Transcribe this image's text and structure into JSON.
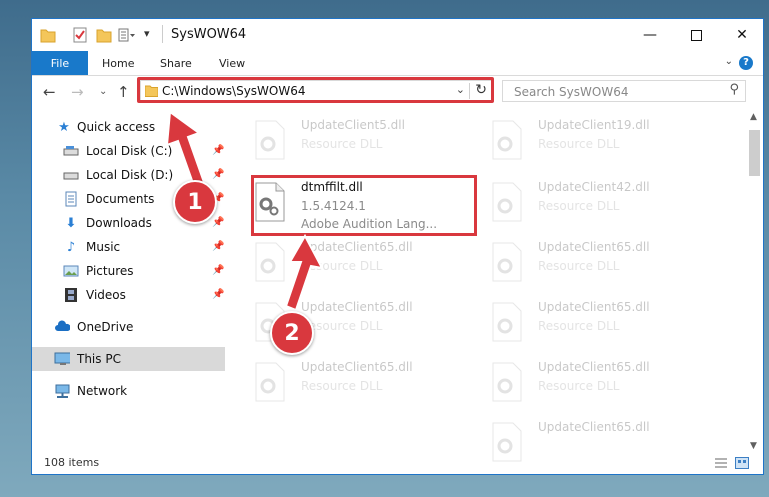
{
  "window": {
    "title": "SysWOW64"
  },
  "ribbon": {
    "file": "File",
    "tabs": [
      "Home",
      "Share",
      "View"
    ],
    "help": "?"
  },
  "address": {
    "path": "C:\\Windows\\SysWOW64"
  },
  "search": {
    "placeholder": "Search SysWOW64"
  },
  "sidebar": {
    "items": [
      {
        "label": "Quick access",
        "icon": "star-icon"
      },
      {
        "label": "Local Disk (C:)",
        "icon": "drive-icon"
      },
      {
        "label": "Local Disk (D:)",
        "icon": "drive-icon"
      },
      {
        "label": "Documents",
        "icon": "documents-icon"
      },
      {
        "label": "Downloads",
        "icon": "download-arrow-icon"
      },
      {
        "label": "Music",
        "icon": "music-note-icon"
      },
      {
        "label": "Pictures",
        "icon": "pictures-icon"
      },
      {
        "label": "Videos",
        "icon": "film-icon"
      },
      {
        "label": "OneDrive",
        "icon": "cloud-icon"
      },
      {
        "label": "This PC",
        "icon": "computer-icon"
      },
      {
        "label": "Network",
        "icon": "network-icon"
      }
    ]
  },
  "files": [
    {
      "name": "UpdateClient5.dll",
      "type": "Resource DLL"
    },
    {
      "name": "UpdateClient19.dll",
      "type": "Resource DLL"
    },
    {
      "name": "dtmffilt.dll",
      "version": "1.5.4124.1",
      "description": "Adobe Audition Lang..."
    },
    {
      "name": "UpdateClient42.dll",
      "type": "Resource DLL"
    },
    {
      "name": "UpdateClient65.dll",
      "type": "Resource DLL"
    },
    {
      "name": "UpdateClient65.dll",
      "type": "Resource DLL"
    },
    {
      "name": "UpdateClient65.dll",
      "type": "Resource DLL"
    },
    {
      "name": "UpdateClient65.dll",
      "type": "Resource DLL"
    },
    {
      "name": "UpdateClient65.dll",
      "type": "Resource DLL"
    },
    {
      "name": "UpdateClient65.dll",
      "type": "Resource DLL"
    },
    {
      "name": "UpdateClient65.dll",
      "type": "Resource DLL"
    }
  ],
  "status": {
    "count": "108 items"
  },
  "callouts": [
    "1",
    "2"
  ],
  "colors": {
    "accent": "#1979ca",
    "highlight": "#d9383e",
    "selected": "#d9d9d9"
  }
}
